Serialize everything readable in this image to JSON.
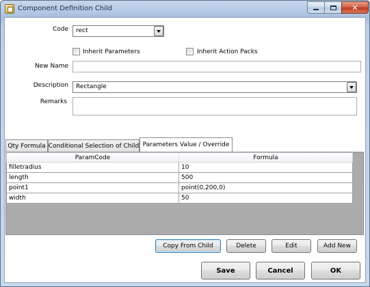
{
  "window": {
    "title": "Component Definition Child"
  },
  "form": {
    "code_label": "Code",
    "code_value": "rect",
    "inherit_parameters_label": "Inherit Parameters",
    "inherit_parameters_checked": false,
    "inherit_action_packs_label": "Inherit Action Packs",
    "inherit_action_packs_checked": false,
    "new_name_label": "New Name",
    "new_name_value": "",
    "description_label": "Description",
    "description_value": "Rectangle",
    "remarks_label": "Remarks",
    "remarks_value": ""
  },
  "tabs": [
    {
      "label": "Qty Formula",
      "active": false
    },
    {
      "label": "Conditional Selection of Child",
      "active": false
    },
    {
      "label": "Parameters Value / Override",
      "active": true
    }
  ],
  "grid": {
    "columns": [
      "ParamCode",
      "Formula"
    ],
    "rows": [
      {
        "param": "filletradius",
        "formula": "10"
      },
      {
        "param": "length",
        "formula": "500"
      },
      {
        "param": "point1",
        "formula": "point(0,200,0)"
      },
      {
        "param": "width",
        "formula": "50"
      }
    ]
  },
  "tab_buttons": {
    "copy_from_child": "Copy From Child",
    "delete": "Delete",
    "edit": "Edit",
    "add_new": "Add New"
  },
  "dialog_buttons": {
    "save": "Save",
    "cancel": "Cancel",
    "ok": "OK"
  },
  "icons": {
    "title_icon": "component-window-icon",
    "minimize": "minimize-icon",
    "maximize": "maximize-icon",
    "close": "close-icon",
    "dropdown": "chevron-down-icon"
  },
  "colors": {
    "titlebar": "#a9c1df",
    "client_bg": "#ffffff",
    "grid_empty_bg": "#ababab",
    "default_button_border": "#3c7fb1",
    "close_button": "#c94a2d"
  }
}
